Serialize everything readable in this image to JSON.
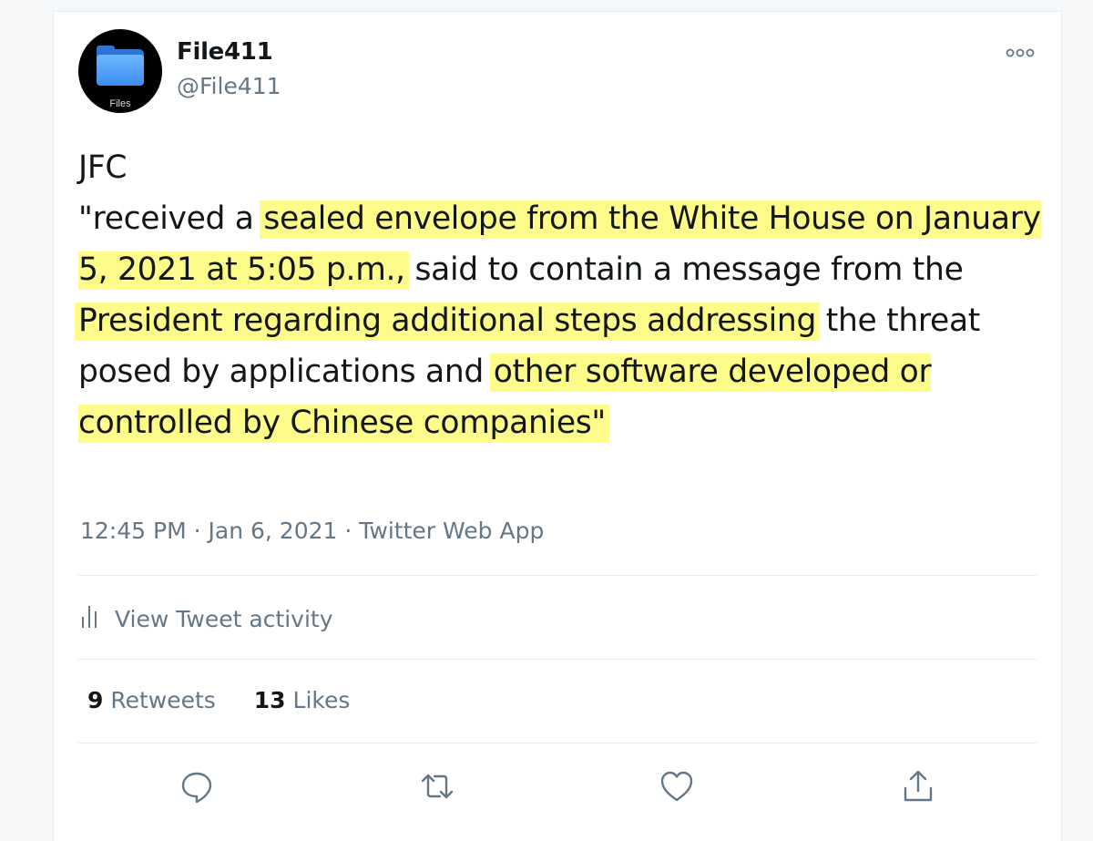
{
  "user": {
    "display_name": "File411",
    "handle": "@File411",
    "avatar_caption": "Files"
  },
  "tweet": {
    "parts": [
      {
        "t": "JFC\n\"received a ",
        "hl": false
      },
      {
        "t": "sealed envelope from the White House on January 5, 2021 at 5:05 p.m.,",
        "hl": true
      },
      {
        "t": " said to contain a message from the ",
        "hl": false
      },
      {
        "t": "President regarding additional steps addressing",
        "hl": true
      },
      {
        "t": " the threat posed by applications and ",
        "hl": false
      },
      {
        "t": "other software developed or controlled by Chinese companies\"",
        "hl": true
      }
    ],
    "highlight_color": "#fdfb8a"
  },
  "meta": {
    "time": "12:45 PM",
    "date": "Jan 6, 2021",
    "source": "Twitter Web App"
  },
  "activity": {
    "label": "View Tweet activity"
  },
  "stats": {
    "retweets_count": "9",
    "retweets_label": "Retweets",
    "likes_count": "13",
    "likes_label": "Likes"
  },
  "actions": [
    "reply-icon",
    "retweet-icon",
    "like-icon",
    "share-icon"
  ],
  "colors": {
    "text": "#14171a",
    "secondary": "#657786",
    "divider": "#e6ecf0"
  }
}
